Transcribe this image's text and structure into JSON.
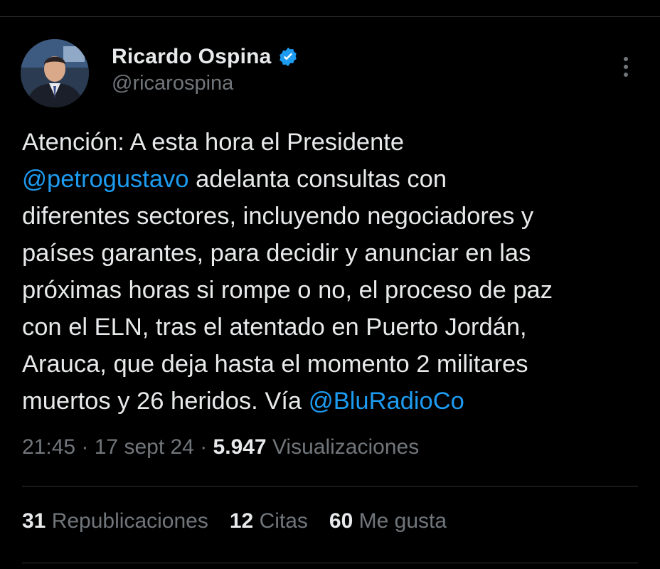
{
  "author": {
    "name": "Ricardo Ospina",
    "handle": "@ricarospina",
    "verified_icon": "verified-badge-icon",
    "avatar_icon": "avatar-photo"
  },
  "more_icon": "more-options-icon",
  "tweet": {
    "lines": [
      [
        {
          "text": "Atención: A esta hora el Presidente",
          "type": "text"
        }
      ],
      [
        {
          "text": "@petrogustavo",
          "type": "mention"
        },
        {
          "text": " adelanta consultas con",
          "type": "text"
        }
      ],
      [
        {
          "text": "diferentes sectores, incluyendo negociadores y",
          "type": "text"
        }
      ],
      [
        {
          "text": "países garantes, para decidir y anunciar en las",
          "type": "text"
        }
      ],
      [
        {
          "text": "próximas horas si rompe o no, el proceso de paz",
          "type": "text"
        }
      ],
      [
        {
          "text": "con el ELN, tras el atentado en Puerto Jordán,",
          "type": "text"
        }
      ],
      [
        {
          "text": "Arauca, que deja hasta el momento 2 militares",
          "type": "text"
        }
      ],
      [
        {
          "text": "muertos y 26 heridos. Vía ",
          "type": "text"
        },
        {
          "text": "@BluRadioCo",
          "type": "mention"
        }
      ]
    ]
  },
  "meta": {
    "time": "21:45",
    "sep1": " · ",
    "date": "17 sept 24",
    "sep2": " · ",
    "views_count": "5.947",
    "views_label": " Visualizaciones"
  },
  "stats": {
    "reposts_count": "31",
    "reposts_label": " Republicaciones",
    "quotes_count": "12",
    "quotes_label": " Citas",
    "likes_count": "60",
    "likes_label": " Me gusta"
  },
  "colors": {
    "background": "#000000",
    "text": "#e7e9ea",
    "secondary": "#71767b",
    "link": "#1d9bf0",
    "divider": "#2f3336"
  }
}
